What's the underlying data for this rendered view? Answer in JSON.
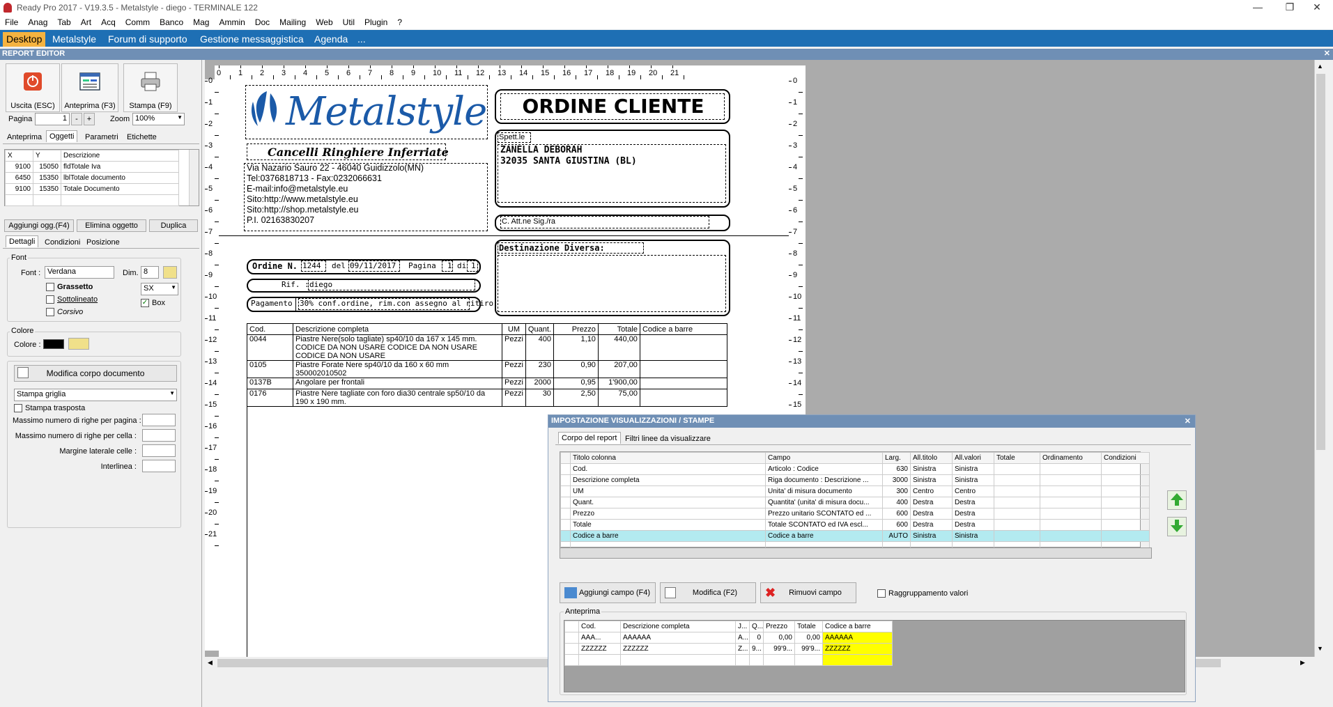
{
  "window": {
    "title": "Ready Pro 2017 - V19.3.5 - Metalstyle - diego - TERMINALE 122",
    "minimize": "—",
    "restore": "❐",
    "close": "✕"
  },
  "menu": [
    "File",
    "Anag",
    "Tab",
    "Art",
    "Acq",
    "Comm",
    "Banco",
    "Mag",
    "Ammin",
    "Doc",
    "Mailing",
    "Web",
    "Util",
    "Plugin",
    "?"
  ],
  "tabs": [
    "Desktop",
    "Metalstyle",
    "Forum di supporto",
    "Gestione messaggistica",
    "Agenda",
    "..."
  ],
  "editor_header": "REPORT EDITOR",
  "editor_close": "✕",
  "toolbar": {
    "exit": "Uscita (ESC)",
    "preview": "Anteprima (F3)",
    "print": "Stampa (F9)",
    "page_label": "Pagina",
    "page_value": "1",
    "minus": "-",
    "plus": "+",
    "zoom_label": "Zoom",
    "zoom_value": "100%"
  },
  "left_tabs": [
    "Anteprima",
    "Oggetti",
    "Parametri",
    "Etichette"
  ],
  "objects_table": {
    "headers": [
      "X",
      "Y",
      "Descrizione"
    ],
    "rows": [
      [
        "9100",
        "15050",
        "fldTotale Iva"
      ],
      [
        "6450",
        "15350",
        "lblTotale documento"
      ],
      [
        "9100",
        "15350",
        "Totale Documento"
      ]
    ]
  },
  "object_buttons": [
    "Aggiungi ogg.(F4)",
    "Elimina oggetto",
    "Duplica"
  ],
  "detail_tabs": [
    "Dettagli",
    "Condizioni",
    "Posizione"
  ],
  "font_group": {
    "title": "Font",
    "font_label": "Font :",
    "font_value": "Verdana",
    "dim_label": "Dim.",
    "dim_value": "8",
    "bold": "Grassetto",
    "underline": "Sottolineato",
    "italic": "Corsivo",
    "align_value": "SX",
    "box": "Box"
  },
  "color_group": {
    "title": "Colore",
    "color_label": "Colore :",
    "color_value": "#000000"
  },
  "body_group": {
    "modify_button": "Modifica corpo documento",
    "print_option": "Stampa griglia",
    "transposed": "Stampa trasposta",
    "max_rows_page": "Massimo numero di righe per pagina :",
    "max_rows_cell": "Massimo numero di righe per cella :",
    "cell_margin": "Margine laterale celle :",
    "line_spacing": "Interlinea :"
  },
  "ruler": {
    "h": [
      "0",
      "1",
      "2",
      "3",
      "4",
      "5",
      "6",
      "7",
      "8",
      "9",
      "10",
      "11",
      "12",
      "13",
      "14",
      "15",
      "16",
      "17",
      "18",
      "19",
      "20",
      "21"
    ],
    "v": [
      "0",
      "1",
      "2",
      "3",
      "4",
      "5",
      "6",
      "7",
      "8",
      "9",
      "10",
      "11",
      "12",
      "13",
      "14",
      "15",
      "16",
      "17",
      "18",
      "19",
      "20",
      "21"
    ]
  },
  "report": {
    "logo_text": "Metalstyle",
    "logo_sub": "Cancelli Ringhiere Inferriate",
    "company_lines": [
      "Via Nazario Sauro 22 - 46040 Guidizzolo(MN)",
      "Tel:0376818713 - Fax:0232066631",
      "E-mail:info@metalstyle.eu",
      "Sito:http://www.metalstyle.eu",
      "Sito:http://shop.metalstyle.eu",
      "P.I. 02163830207"
    ],
    "doc_title": "ORDINE CLIENTE",
    "spett": "Spett.le",
    "customer_name": "ZANELLA DEBORAH",
    "customer_city": "32035 SANTA GIUSTINA (BL)",
    "attn": "C. Att.ne Sig./ra",
    "dest_label": "Destinazione Diversa:",
    "order_label": "Ordine N.",
    "order_number": "1244",
    "del": "del",
    "order_date": "09/11/2017",
    "page_label": "Pagina",
    "page_num": "1",
    "of": "di",
    "page_total": "1",
    "rif_label": "Rif. :",
    "rif_value": "diego",
    "payment_label": "Pagamento",
    "payment_value": "30% conf.ordine, rim.con assegno al ritiro",
    "table_headers": [
      "Cod.",
      "Descrizione completa",
      "UM",
      "Quant.",
      "Prezzo",
      "Totale",
      "Codice a barre"
    ],
    "lines": [
      {
        "cod": "0044",
        "desc": "Piastre Nere(solo tagliate) sp40/10 da 167 x 145 mm.  CODICE DA NON USARE CODICE DA NON USARE CODICE DA NON USARE",
        "um": "Pezzi",
        "qty": "400",
        "price": "1,10",
        "total": "440,00"
      },
      {
        "cod": "0105",
        "desc": "Piastre Forate Nere sp40/10 da 160 x 60 mm  350002010502",
        "um": "Pezzi",
        "qty": "230",
        "price": "0,90",
        "total": "207,00"
      },
      {
        "cod": "0137B",
        "desc": "Angolare per frontali",
        "um": "Pezzi",
        "qty": "2000",
        "price": "0,95",
        "total": "1'900,00"
      },
      {
        "cod": "0176",
        "desc": "Piastre Nere tagliate con foro dia30 centrale sp50/10 da 190 x 190 mm.",
        "um": "Pezzi",
        "qty": "30",
        "price": "2,50",
        "total": "75,00"
      }
    ]
  },
  "dialog": {
    "title": "IMPOSTAZIONE VISUALIZZAZIONI / STAMPE",
    "close": "✕",
    "tabs": [
      "Corpo del report",
      "Filtri linee da visualizzare"
    ],
    "headers": [
      "Titolo colonna",
      "Campo",
      "Larg.",
      "All.titolo",
      "All.valori",
      "Totale",
      "Ordinamento",
      "Condizioni"
    ],
    "rows": [
      [
        "Cod.",
        "Articolo : Codice",
        "630",
        "Sinistra",
        "Sinistra",
        "",
        "",
        ""
      ],
      [
        "Descrizione completa",
        "Riga documento : Descrizione ...",
        "3000",
        "Sinistra",
        "Sinistra",
        "",
        "",
        ""
      ],
      [
        "UM",
        "Unita' di misura documento",
        "300",
        "Centro",
        "Centro",
        "",
        "",
        ""
      ],
      [
        "Quant.",
        "Quantita' (unita' di misura docu...",
        "400",
        "Destra",
        "Destra",
        "",
        "",
        ""
      ],
      [
        "Prezzo",
        "Prezzo unitario SCONTATO ed ...",
        "600",
        "Destra",
        "Destra",
        "",
        "",
        ""
      ],
      [
        "Totale",
        "Totale SCONTATO ed IVA escl...",
        "600",
        "Destra",
        "Destra",
        "",
        "",
        ""
      ],
      [
        "Codice a barre",
        "Codice a barre",
        "AUTO",
        "Sinistra",
        "Sinistra",
        "",
        "",
        ""
      ]
    ],
    "selected_row": 6,
    "add_field": "Aggiungi campo (F4)",
    "modify": "Modifica (F2)",
    "remove": "Rimuovi campo",
    "grouping": "Raggruppamento valori",
    "preview_label": "Anteprima",
    "preview_headers": [
      "Cod.",
      "Descrizione completa",
      "J...",
      "Q...",
      "Prezzo",
      "Totale",
      "Codice a barre"
    ],
    "preview_rows": [
      [
        "AAA...",
        "AAAAAA",
        "A...",
        "0",
        "0,00",
        "0,00",
        "AAAAAA"
      ],
      [
        "ZZZZZZ",
        "ZZZZZZ",
        "Z...",
        "9...",
        "99'9...",
        "99'9...",
        "ZZZZZZ"
      ]
    ]
  }
}
